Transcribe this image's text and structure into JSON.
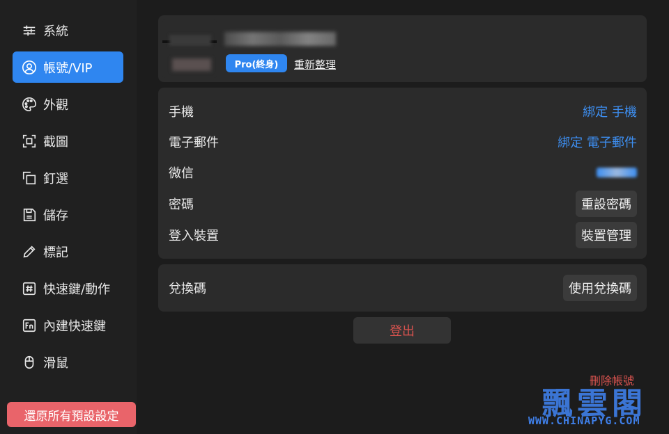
{
  "sidebar": {
    "items": [
      {
        "label": "系統",
        "icon": "sliders-icon"
      },
      {
        "label": "帳號/VIP",
        "icon": "user-circle-icon",
        "active": true
      },
      {
        "label": "外觀",
        "icon": "palette-icon"
      },
      {
        "label": "截圖",
        "icon": "screenshot-icon"
      },
      {
        "label": "釘選",
        "icon": "pin-copy-icon"
      },
      {
        "label": "儲存",
        "icon": "save-icon"
      },
      {
        "label": "標記",
        "icon": "pencil-icon"
      },
      {
        "label": "快速鍵/動作",
        "icon": "hash-key-icon"
      },
      {
        "label": "內建快速鍵",
        "icon": "fn-key-icon"
      },
      {
        "label": "滑鼠",
        "icon": "mouse-icon"
      }
    ],
    "reset_all_label": "還原所有預設設定"
  },
  "profile": {
    "badge": "Pro(終身)",
    "refresh_label": "重新整理"
  },
  "settings": {
    "rows": [
      {
        "label": "手機",
        "action": "綁定 手機"
      },
      {
        "label": "電子郵件",
        "action": "綁定 電子郵件"
      },
      {
        "label": "微信"
      },
      {
        "label": "密碼",
        "action": "重設密碼"
      },
      {
        "label": "登入裝置",
        "action": "裝置管理"
      }
    ]
  },
  "redeem": {
    "label": "兌換碼",
    "action": "使用兌換碼"
  },
  "logout_label": "登出",
  "delete_account_label": "刪除帳號",
  "watermark": {
    "title": "飄雲閣",
    "url": "WWW.CHINAPYG.COM"
  },
  "colors": {
    "accent": "#2f86f0",
    "danger": "#d9534f",
    "reset": "#e9646a"
  }
}
